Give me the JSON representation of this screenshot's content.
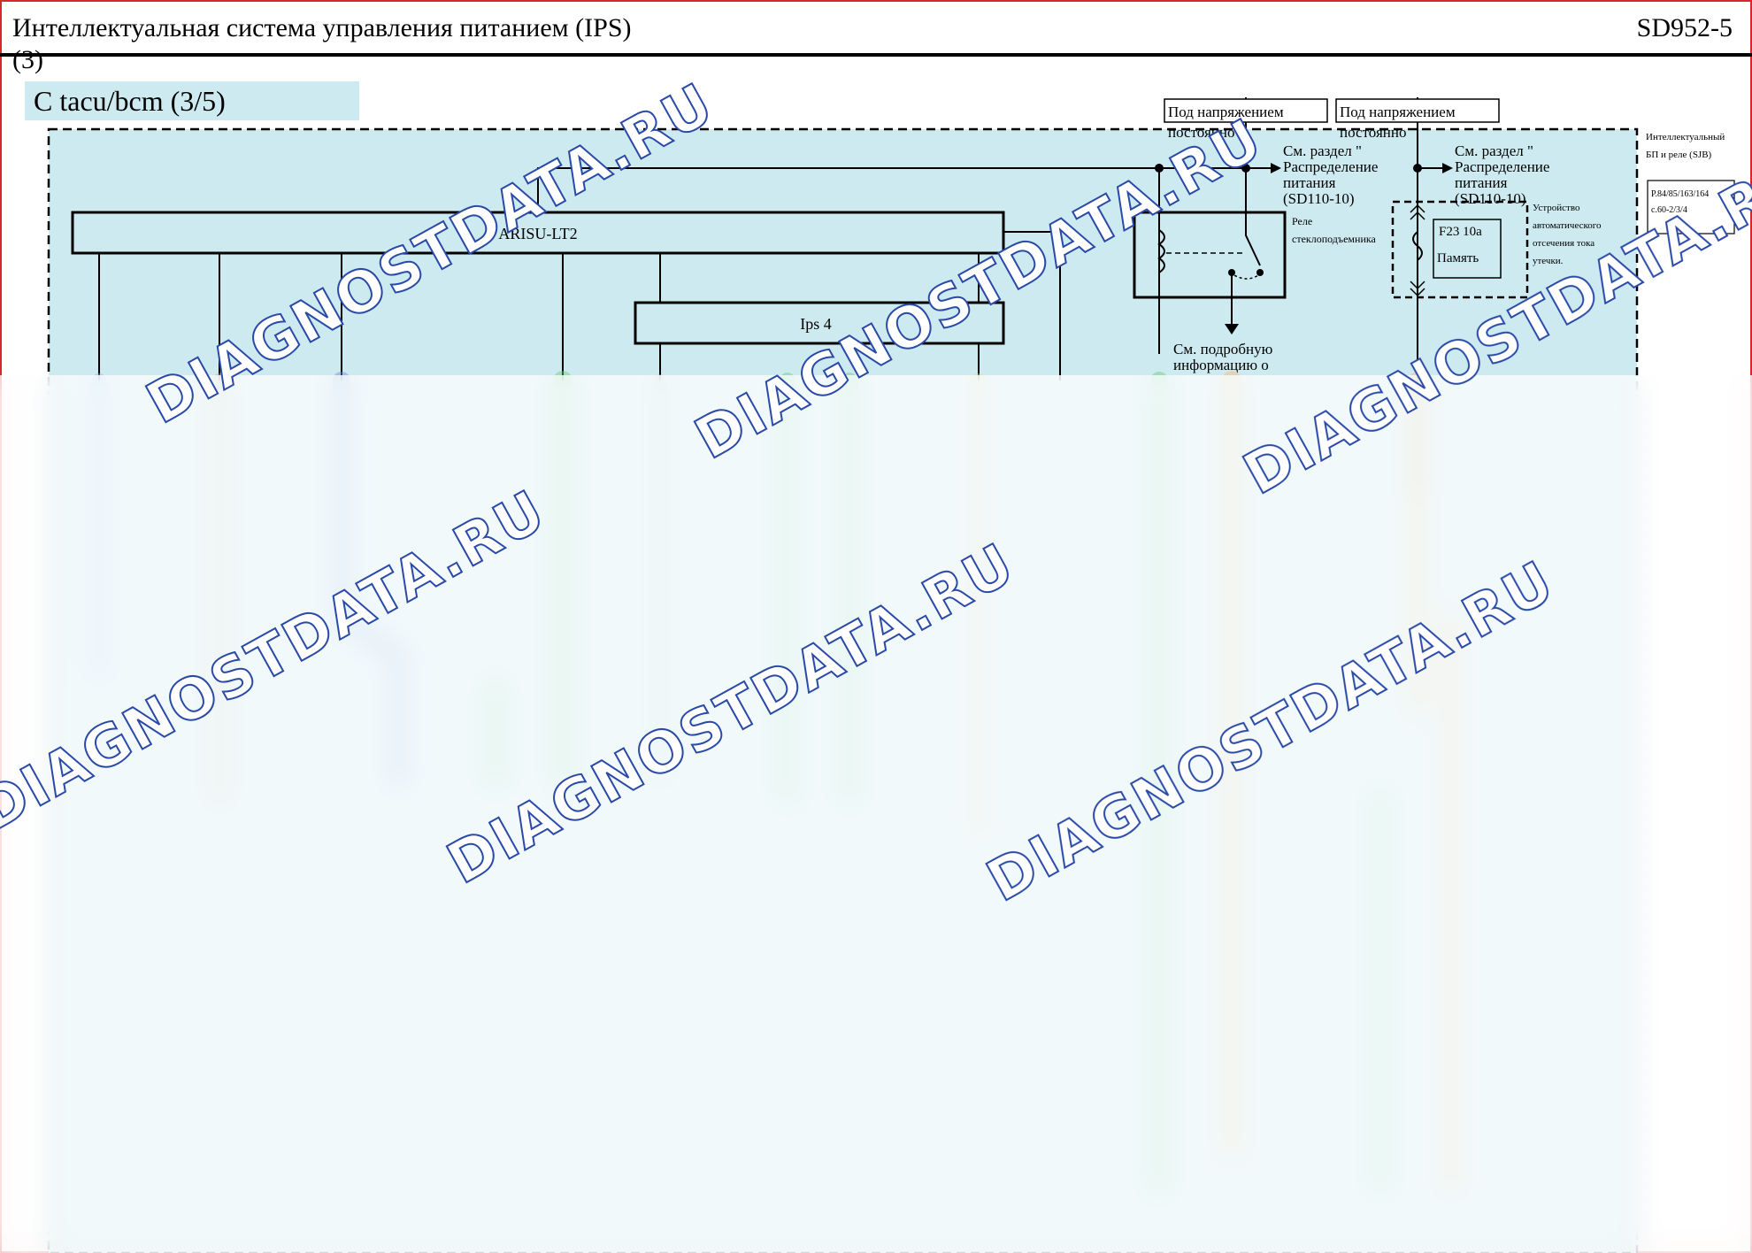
{
  "header": {
    "title": "Интеллектуальная система управления питанием (IPS) (3)",
    "code": "SD952-5"
  },
  "variant_label": "C tacu/bcm (3/5)",
  "components": {
    "arisu": "ARISU-LT2",
    "ips4": "Ips 4"
  },
  "power_boxes": {
    "left": [
      "Под напряжением",
      "постоянно"
    ],
    "right": [
      "Под напряжением",
      "постоянно"
    ]
  },
  "power_refs": {
    "left": [
      "См. раздел \"",
      "Распределение",
      "питания",
      "(SD110-10)"
    ],
    "right": [
      "См. раздел \"",
      "Распределение",
      "питания",
      "(SD110-10)"
    ]
  },
  "relay": {
    "label": [
      "Реле",
      "стеклоподъемника"
    ]
  },
  "relay_ref": [
    "См. подробную",
    "информацию о"
  ],
  "fuse": {
    "id": "F23 10a",
    "name": "Память"
  },
  "leak_device": [
    "Устройство",
    "автоматического",
    "отсечения тока",
    "утечки."
  ],
  "sjb": {
    "title": [
      "Интеллектуальный",
      "БП и реле (SJB)"
    ],
    "pages": [
      "P.84/85/163/164",
      "с.60-2/3/4"
    ]
  },
  "watermarks": [
    "DIAGNOSTDATA.RU"
  ],
  "colors": {
    "panel": "#cdeaf0",
    "border": "#d8282c",
    "watermark": "#2a4aa8"
  }
}
